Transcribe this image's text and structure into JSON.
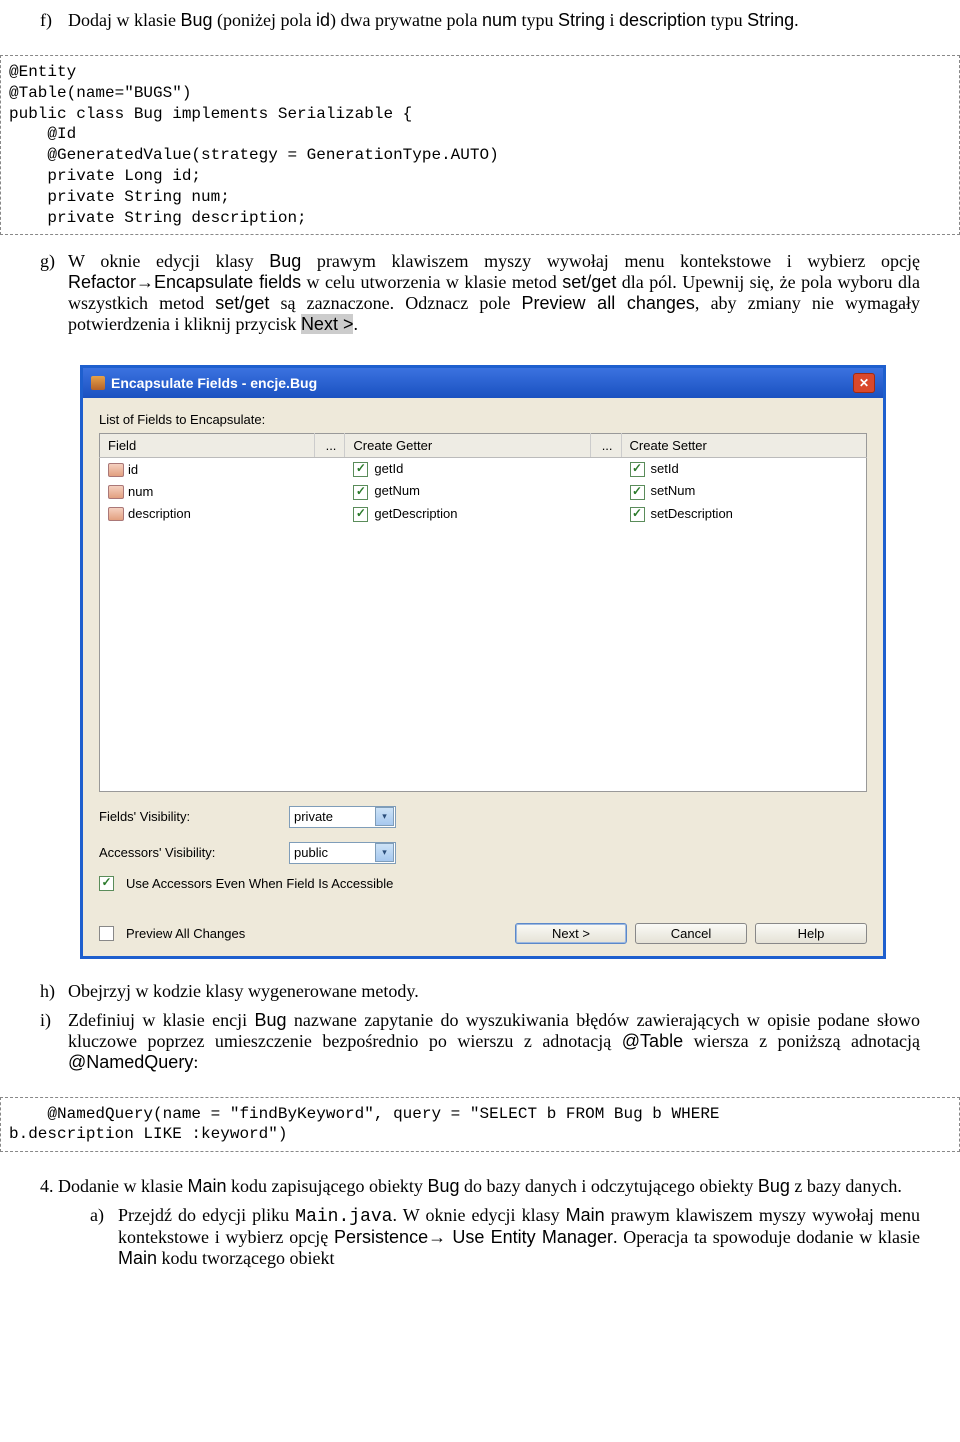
{
  "item_f": {
    "label": "f)",
    "text_parts": [
      "Dodaj w klasie ",
      "Bug",
      " (poniżej pola ",
      "id",
      ") dwa prywatne pola ",
      "num",
      " typu ",
      "String",
      " i ",
      "description",
      " typu ",
      "String",
      "."
    ]
  },
  "code_f": "@Entity\n@Table(name=\"BUGS\")\npublic class Bug implements Serializable {\n    @Id\n    @GeneratedValue(strategy = GenerationType.AUTO)\n    private Long id;\n    private String num;\n    private String description;",
  "item_g": {
    "label": "g)",
    "text_parts": [
      "W oknie edycji klasy ",
      "Bug",
      " prawym klawiszem myszy wywołaj menu kontekstowe i wybierz opcję ",
      "Refactor→Encapsulate fields",
      " w celu utworzenia w klasie metod ",
      "set/get",
      " dla pól. Upewnij się, że pola wyboru dla wszystkich metod ",
      "set/get",
      " są zaznaczone. Odznacz pole ",
      "Preview all changes",
      ", aby zmiany nie wymagały potwierdzenia i kliknij przycisk ",
      "Next >",
      "."
    ]
  },
  "dialog": {
    "title": "Encapsulate Fields - encje.Bug",
    "list_label": "List of Fields to Encapsulate:",
    "columns": {
      "field": "Field",
      "dots": "...",
      "getter": "Create Getter",
      "setter": "Create Setter"
    },
    "rows": [
      {
        "name": "id",
        "getter": "getId",
        "setter": "setId"
      },
      {
        "name": "num",
        "getter": "getNum",
        "setter": "setNum"
      },
      {
        "name": "description",
        "getter": "getDescription",
        "setter": "setDescription"
      }
    ],
    "fields_vis_label": "Fields' Visibility:",
    "fields_vis_value": "private",
    "accessors_vis_label": "Accessors' Visibility:",
    "accessors_vis_value": "public",
    "use_accessors": "Use Accessors Even When Field Is Accessible",
    "preview_all": "Preview All Changes",
    "btn_next": "Next >",
    "btn_cancel": "Cancel",
    "btn_help": "Help"
  },
  "item_h": {
    "label": "h)",
    "text": "Obejrzyj w kodzie klasy wygenerowane metody."
  },
  "item_i": {
    "label": "i)",
    "text_parts": [
      "Zdefiniuj w klasie encji ",
      "Bug",
      " nazwane zapytanie do wyszukiwania błędów zawierających w opisie podane słowo kluczowe poprzez umieszczenie bezpośrednio po wierszu z adnotacją ",
      "@Table",
      " wiersza z poniższą adnotacją ",
      "@NamedQuery",
      ":"
    ]
  },
  "code_i": "    @NamedQuery(name = \"findByKeyword\", query = \"SELECT b FROM Bug b WHERE\nb.description LIKE :keyword\")",
  "section4": {
    "text_parts": [
      "4. Dodanie w klasie ",
      "Main",
      " kodu zapisującego obiekty ",
      "Bug",
      " do bazy danych i odczytującego obiekty ",
      "Bug",
      " z bazy danych."
    ]
  },
  "item_a": {
    "label": "a)",
    "text_parts": [
      "Przejdź do edycji pliku ",
      "Main.java",
      ". W oknie edycji klasy ",
      "Main",
      " prawym klawiszem myszy wywołaj menu kontekstowe i wybierz opcję ",
      "Persistence→ Use Entity Manager",
      ". Operacja ta spowoduje dodanie w klasie ",
      "Main",
      " kodu tworzącego obiekt"
    ]
  }
}
